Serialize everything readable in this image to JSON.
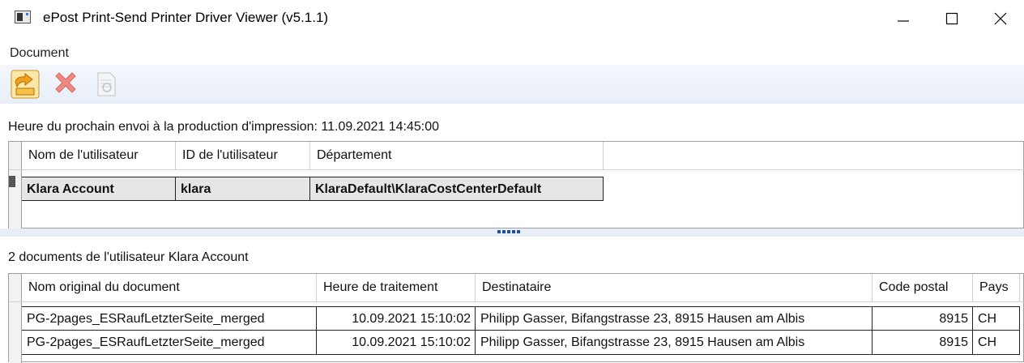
{
  "window": {
    "title": "ePost Print-Send Printer Driver Viewer (v5.1.1)",
    "buttons": [
      "minimize-icon",
      "maximize-icon",
      "close-icon"
    ]
  },
  "menu": {
    "items": [
      {
        "label": "Document"
      }
    ]
  },
  "toolbar": {
    "buttons": [
      {
        "name": "import-icon",
        "enabled": true
      },
      {
        "name": "delete-icon",
        "enabled": false
      },
      {
        "name": "preview-icon",
        "enabled": false
      }
    ]
  },
  "next_send_label": "Heure du prochain envoi à la production d'impression: 11.09.2021 14:45:00",
  "users_table": {
    "columns": [
      "Nom de l'utilisateur",
      "ID de l'utilisateur",
      "Département"
    ],
    "rows": [
      {
        "name": "Klara Account",
        "id": "klara",
        "department": "KlaraDefault\\KlaraCostCenterDefault"
      }
    ]
  },
  "documents_label": "2 documents de l'utilisateur Klara Account",
  "documents_table": {
    "columns": [
      "Nom original du document",
      "Heure de traitement",
      "Destinataire",
      "Code postal",
      "Pays"
    ],
    "rows": [
      {
        "document": "PG-2pages_ESRaufLetzterSeite_merged",
        "time": "10.09.2021 15:10:02",
        "recipient": "Philipp Gasser, Bifangstrasse 23, 8915 Hausen am Albis",
        "postal_code": "8915",
        "country": "CH"
      },
      {
        "document": "PG-2pages_ESRaufLetzterSeite_merged",
        "time": "10.09.2021 15:10:02",
        "recipient": "Philipp Gasser, Bifangstrasse 23, 8915 Hausen am Albis",
        "postal_code": "8915",
        "country": "CH"
      }
    ]
  },
  "colors": {
    "toolbar_bg": "#e8eef8",
    "splitter_dots": "#1f4e9a",
    "delete_red": "#e05a4a",
    "import_orange": "#f0a020"
  }
}
